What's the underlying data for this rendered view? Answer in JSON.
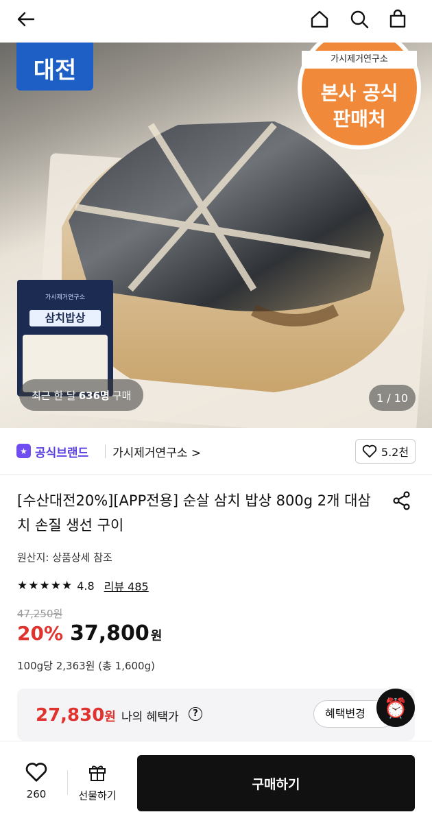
{
  "hero": {
    "badge_left": "대전",
    "badge_right_sub": "가시제거연구소",
    "badge_right_line1": "본사 공식",
    "badge_right_line2": "판매처",
    "package_top": "가시제거연구소",
    "package_title": "삼치밥상",
    "recent_prefix": "최근 한 달",
    "recent_count": "636명",
    "recent_suffix": "구매",
    "pager": "1 / 10"
  },
  "brand": {
    "label": "공식브랜드",
    "name": "가시제거연구소 >",
    "likes": "5.2천"
  },
  "product": {
    "title": "[수산대전20%][APP전용] 순살 삼치 밥상 800g 2개 대삼치 손질 생선 구이",
    "origin": "원산지: 상품상세 참조",
    "stars": "★★★★★",
    "rating": "4.8",
    "review": "리뷰 485",
    "old_price": "47,250원",
    "discount": "20%",
    "price": "37,800",
    "won": "원",
    "unit_price": "100g당 2,363원 (총 1,600g)"
  },
  "benefit": {
    "price": "27,830",
    "won": "원",
    "label": "나의 혜택가",
    "help": "?",
    "change": "혜택변경"
  },
  "bottom": {
    "wish_count": "260",
    "gift_label": "선물하기",
    "buy_label": "구매하기"
  }
}
